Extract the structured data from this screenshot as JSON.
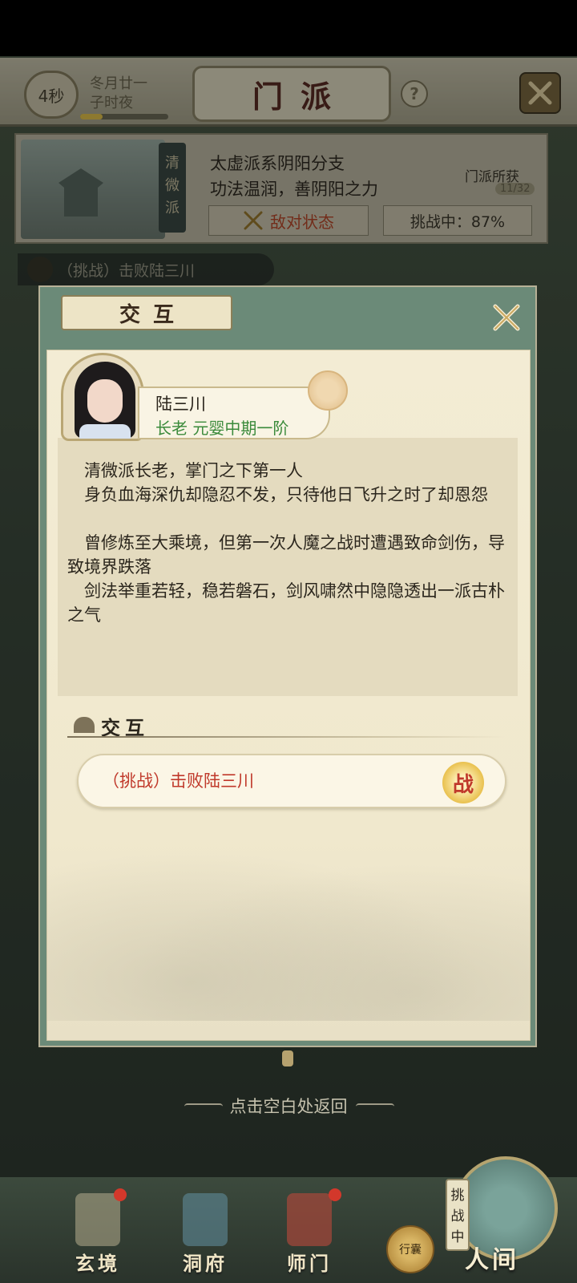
{
  "header": {
    "timer": "4秒",
    "date_line1": "冬月廿一",
    "date_line2": "子时夜",
    "time_progress": 0.25,
    "title": "门派",
    "help": "?"
  },
  "sect": {
    "vertical_name": "清微派",
    "desc_line1": "太虚派系阴阳分支",
    "desc_line2": "功法温润，善阴阳之力",
    "enemy_status": "敌对状态",
    "challenge_progress": "挑战中：87%",
    "gains_label": "门派所获",
    "gains_count": "11/32"
  },
  "quest_banner": "（挑战）击败陆三川",
  "dialog": {
    "title": "交互",
    "npc": {
      "name": "陆三川",
      "rank": "长老 元婴中期一阶"
    },
    "bio": [
      "　清微派长老，掌门之下第一人",
      "　身负血海深仇却隐忍不发，只待他日飞升之时了却恩怨",
      "　曾修炼至大乘境，但第一次人魔之战时遭遇致命剑伤，导致境界跌落",
      "　剑法举重若轻，稳若磐石，剑风啸然中隐隐透出一派古朴之气"
    ],
    "section_title": "交互",
    "actions": [
      {
        "label": "（挑战）击败陆三川",
        "icon_text": "战"
      }
    ]
  },
  "return_hint": "点击空白处返回",
  "nav": {
    "items": [
      {
        "label": "玄境"
      },
      {
        "label": "洞府"
      },
      {
        "label": "师门"
      }
    ],
    "bag_label": "行囊",
    "world_tag": "挑战中",
    "world_label": "人间"
  },
  "colors": {
    "enemy_red": "#b9482a",
    "rank_green": "#3a8a3a",
    "action_red": "#c0392b"
  }
}
